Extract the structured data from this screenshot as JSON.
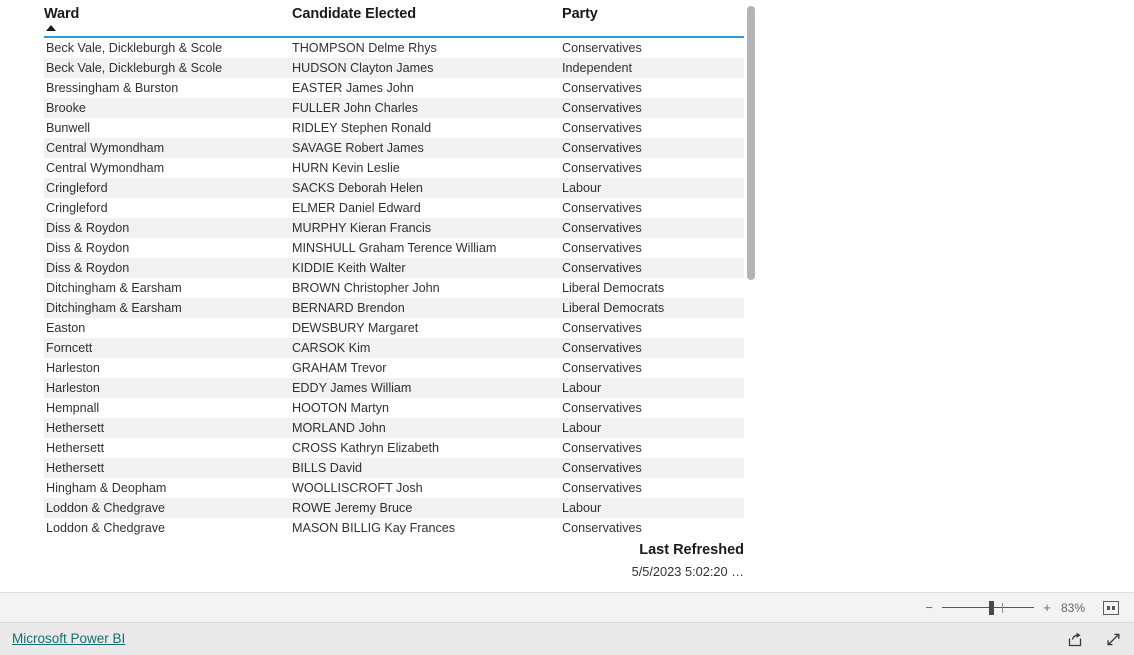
{
  "table": {
    "columns": [
      "Ward",
      "Candidate Elected",
      "Party"
    ],
    "sort": {
      "column": "Ward",
      "direction": "ascending",
      "indicator": "sort-ascending-icon"
    },
    "rows": [
      [
        "Beck Vale, Dickleburgh & Scole",
        "THOMPSON Delme Rhys",
        "Conservatives"
      ],
      [
        "Beck Vale, Dickleburgh & Scole",
        "HUDSON Clayton James",
        "Independent"
      ],
      [
        "Bressingham & Burston",
        "EASTER James John",
        "Conservatives"
      ],
      [
        "Brooke",
        "FULLER John Charles",
        "Conservatives"
      ],
      [
        "Bunwell",
        "RIDLEY Stephen Ronald",
        "Conservatives"
      ],
      [
        "Central Wymondham",
        "SAVAGE Robert James",
        "Conservatives"
      ],
      [
        "Central Wymondham",
        "HURN Kevin Leslie",
        "Conservatives"
      ],
      [
        "Cringleford",
        "SACKS Deborah Helen",
        "Labour"
      ],
      [
        "Cringleford",
        "ELMER Daniel Edward",
        "Conservatives"
      ],
      [
        "Diss & Roydon",
        "MURPHY Kieran Francis",
        "Conservatives"
      ],
      [
        "Diss & Roydon",
        "MINSHULL Graham Terence William",
        "Conservatives"
      ],
      [
        "Diss & Roydon",
        "KIDDIE Keith Walter",
        "Conservatives"
      ],
      [
        "Ditchingham & Earsham",
        "BROWN Christopher John",
        "Liberal Democrats"
      ],
      [
        "Ditchingham & Earsham",
        "BERNARD Brendon",
        "Liberal Democrats"
      ],
      [
        "Easton",
        "DEWSBURY Margaret",
        "Conservatives"
      ],
      [
        "Forncett",
        "CARSOK Kim",
        "Conservatives"
      ],
      [
        "Harleston",
        "GRAHAM Trevor",
        "Conservatives"
      ],
      [
        "Harleston",
        "EDDY James William",
        "Labour"
      ],
      [
        "Hempnall",
        "HOOTON Martyn",
        "Conservatives"
      ],
      [
        "Hethersett",
        "MORLAND John",
        "Labour"
      ],
      [
        "Hethersett",
        "CROSS Kathryn Elizabeth",
        "Conservatives"
      ],
      [
        "Hethersett",
        "BILLS David",
        "Conservatives"
      ],
      [
        "Hingham & Deopham",
        "WOOLLISCROFT Josh",
        "Conservatives"
      ],
      [
        "Loddon & Chedgrave",
        "ROWE Jeremy Bruce",
        "Labour"
      ],
      [
        "Loddon & Chedgrave",
        "MASON BILLIG Kay Frances",
        "Conservatives"
      ]
    ]
  },
  "last_refreshed": {
    "title": "Last Refreshed",
    "value": "5/5/2023 5:02:20 …"
  },
  "zoom_toolbar": {
    "decrease_label": "−",
    "increase_label": "+",
    "percent": "83%",
    "fit_icon": "fit-to-page-icon"
  },
  "footer": {
    "brand_link": "Microsoft Power BI",
    "share_icon": "share-icon",
    "fullscreen_icon": "fullscreen-icon"
  },
  "colors": {
    "header_underline": "#2e9ae0",
    "row_alt": "#f1f1f1",
    "link": "#12726b",
    "scrollbar": "#b4b4b4",
    "toolbar_bg": "#f3f3f3",
    "footer_bg": "#e9e9e9"
  }
}
